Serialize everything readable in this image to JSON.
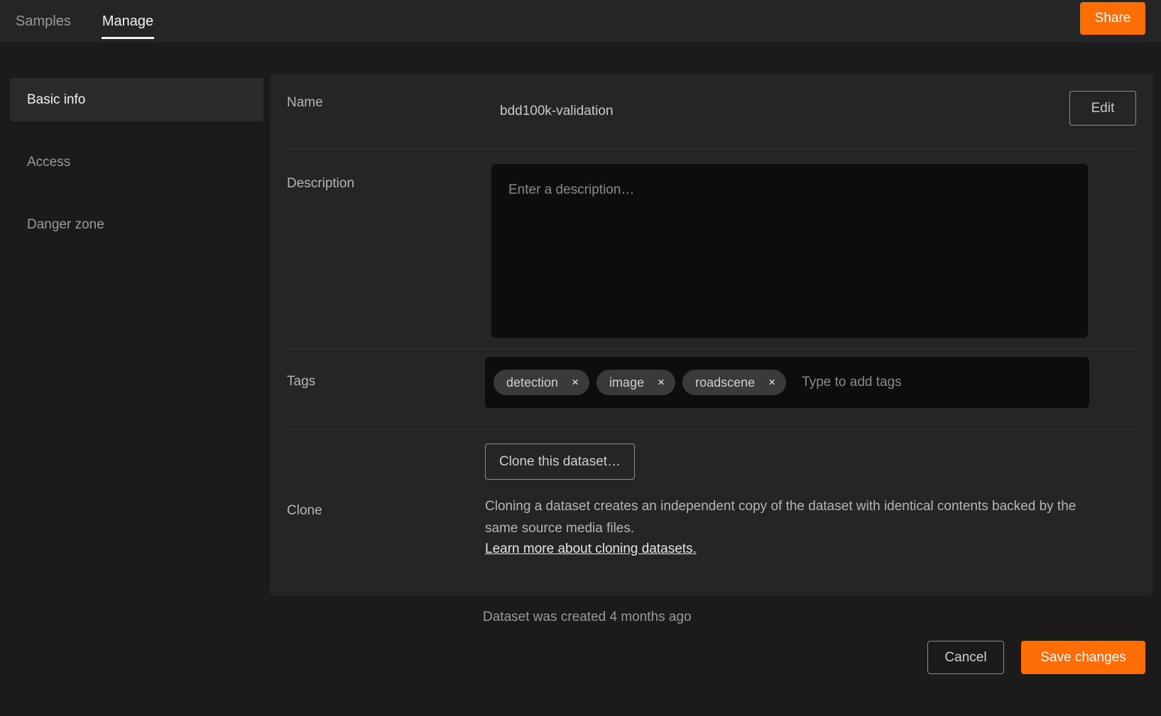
{
  "header": {
    "tabs": [
      {
        "label": "Samples",
        "active": false
      },
      {
        "label": "Manage",
        "active": true
      }
    ],
    "share_label": "Share"
  },
  "sidebar": {
    "items": [
      {
        "label": "Basic info",
        "active": true
      },
      {
        "label": "Access",
        "active": false
      },
      {
        "label": "Danger zone",
        "active": false
      }
    ]
  },
  "main": {
    "name": {
      "label": "Name",
      "value": "bdd100k-validation",
      "edit_label": "Edit"
    },
    "description": {
      "label": "Description",
      "value": "",
      "placeholder": "Enter a description…"
    },
    "tags": {
      "label": "Tags",
      "chips": [
        {
          "label": "detection",
          "remove_icon": "×"
        },
        {
          "label": "image",
          "remove_icon": "×"
        },
        {
          "label": "roadscene",
          "remove_icon": "×"
        }
      ],
      "input_value": "",
      "placeholder": "Type to add tags"
    },
    "clone": {
      "label": "Clone",
      "button_label": "Clone this dataset…",
      "description": "Cloning a dataset creates an independent copy of the dataset with identical contents backed by the same source media files.",
      "link_label": "Learn more about cloning datasets."
    }
  },
  "footer": {
    "created_note": "Dataset was created 4 months ago",
    "cancel_label": "Cancel",
    "save_label": "Save changes"
  },
  "colors": {
    "accent": "#ff6d04",
    "page_bg": "#1b1b1b",
    "panel_bg": "#252525",
    "field_bg": "#0d0d0d",
    "chip_bg": "#3a3a3a",
    "text_primary": "#f2f2f2",
    "text_muted": "#9a9a9a"
  }
}
